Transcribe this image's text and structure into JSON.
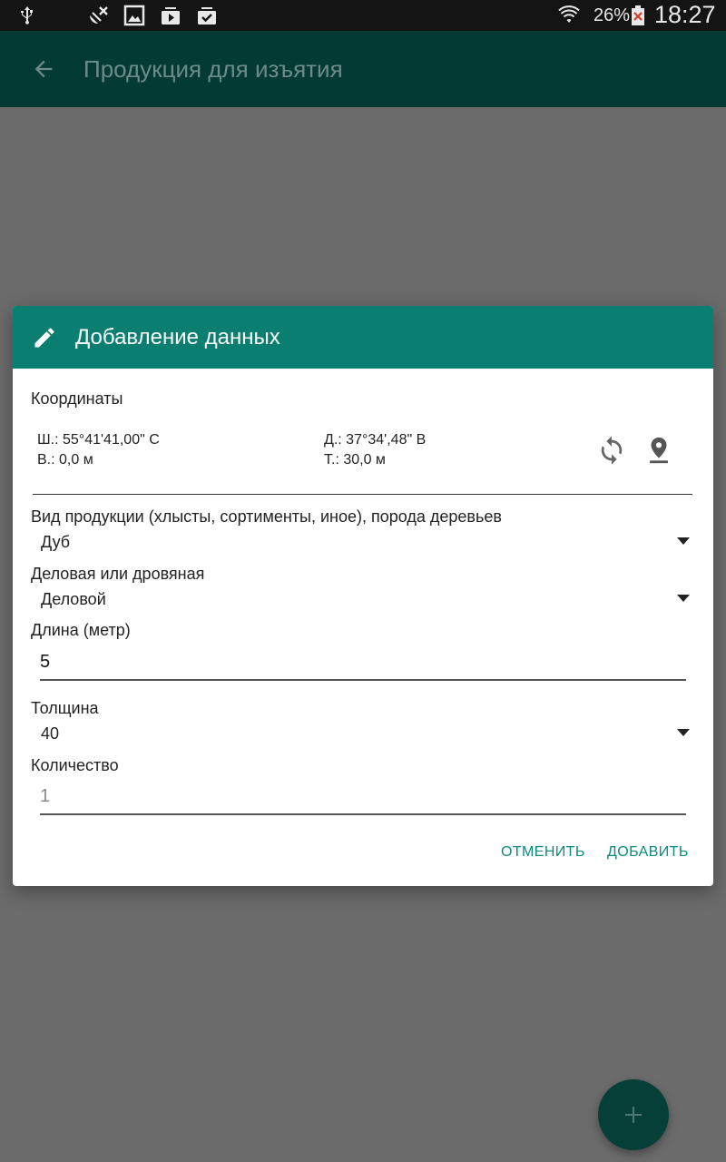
{
  "status_bar": {
    "icons": [
      "usb-icon",
      "satellite-off-icon",
      "image-icon",
      "video-library-icon",
      "check-library-icon",
      "wifi-icon",
      "battery-icon"
    ],
    "battery_percent": "26%",
    "time": "18:27"
  },
  "app_bar": {
    "back_icon": "arrow-back-icon",
    "title": "Продукция для изъятия"
  },
  "dialog": {
    "icon": "pencil-icon",
    "title": "Добавление данных",
    "coordinates": {
      "label": "Координаты",
      "latitude": "Ш.: 55°41'41,00\" С",
      "longitude": "Д.: 37°34',48\" В",
      "altitude": "В.: 0,0 м",
      "accuracy": "Т.: 30,0 м",
      "refresh_icon": "refresh-icon",
      "location_icon": "location-pin-icon"
    },
    "product_type": {
      "label": "Вид продукции (хлысты, сортименты, иное), порода деревьев",
      "value": "Дуб"
    },
    "wood_use": {
      "label": "Деловая или дровяная",
      "value": "Деловой"
    },
    "length": {
      "label": "Длина (метр)",
      "value": "5"
    },
    "thickness": {
      "label": "Толщина",
      "value": "40"
    },
    "quantity": {
      "label": "Количество",
      "placeholder": "1"
    },
    "buttons": {
      "cancel": "ОТМЕНИТЬ",
      "add": "ДОБАВИТЬ"
    }
  },
  "fab": {
    "icon": "plus-icon"
  },
  "colors": {
    "accent": "#0b7e72",
    "scrim": "#6b6b6b",
    "button_text": "#0b8a7d"
  }
}
